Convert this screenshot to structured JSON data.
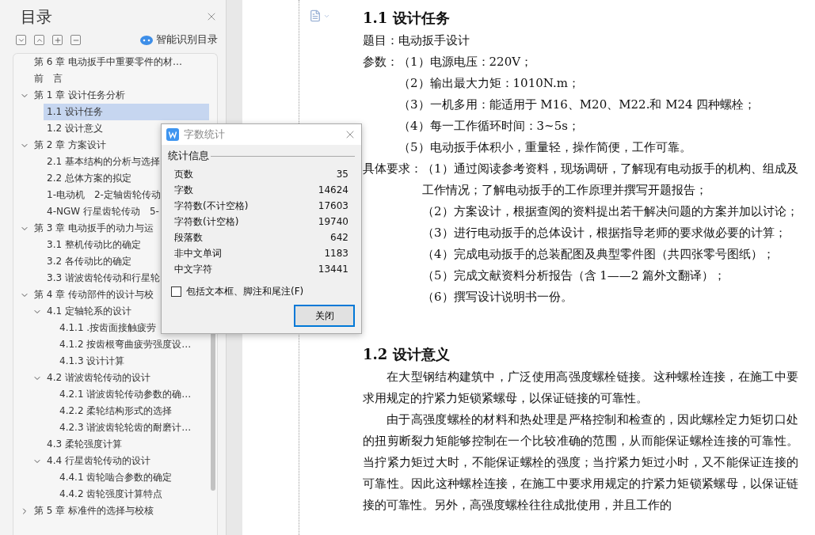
{
  "toc_panel": {
    "title": "目录",
    "smart_button": "智能识别目录",
    "items": [
      {
        "label": "第 6 章 电动扳手中重要零件的材…",
        "selected": false
      },
      {
        "label": "前　言",
        "selected": false
      },
      {
        "label": "第 1 章 设计任务分析",
        "selected": false,
        "expanded": true,
        "children": [
          {
            "label": "1.1 设计任务",
            "selected": true
          },
          {
            "label": "1.2 设计意义",
            "selected": false
          }
        ]
      },
      {
        "label": "第 2 章 方案设计",
        "selected": false,
        "expanded": true,
        "children": [
          {
            "label": "2.1 基本结构的分析与选择",
            "selected": false
          },
          {
            "label": "2.2 总体方案的拟定",
            "selected": false
          },
          {
            "label": "1-电动机　2-定轴齿轮传动",
            "selected": false
          },
          {
            "label": "4-NGW 行星齿轮传动　5-",
            "selected": false
          }
        ]
      },
      {
        "label": "第 3 章 电动扳手的动力与运",
        "selected": false,
        "expanded": true,
        "children": [
          {
            "label": "3.1 整机传动比的确定",
            "selected": false
          },
          {
            "label": "3.2 各传动比的确定",
            "selected": false
          },
          {
            "label": "3.3 谐波齿轮传动和行星轮",
            "selected": false
          }
        ]
      },
      {
        "label": "第 4 章 传动部件的设计与校",
        "selected": false,
        "expanded": true,
        "children": [
          {
            "label": "4.1 定轴轮系的设计",
            "selected": false,
            "expanded": true,
            "children": [
              {
                "label": "4.1.1 .按齿面接触疲劳",
                "selected": false
              },
              {
                "label": "4.1.2 按齿根弯曲疲劳强度设…",
                "selected": false
              },
              {
                "label": "4.1.3 设计计算",
                "selected": false
              }
            ]
          },
          {
            "label": "4.2 谐波齿轮传动的设计",
            "selected": false,
            "expanded": true,
            "children": [
              {
                "label": "4.2.1 谐波齿轮传动参数的确…",
                "selected": false
              },
              {
                "label": "4.2.2 柔轮结构形式的选择",
                "selected": false
              },
              {
                "label": "4.2.3 谐波齿轮轮齿的耐磨计…",
                "selected": false
              }
            ]
          },
          {
            "label": "4.3 柔轮强度计算",
            "selected": false
          },
          {
            "label": "4.4 行星齿轮传动的设计",
            "selected": false,
            "expanded": true,
            "children": [
              {
                "label": "4.4.1 齿轮啮合参数的确定",
                "selected": false
              },
              {
                "label": "4.4.2 齿轮强度计算特点",
                "selected": false
              }
            ]
          }
        ]
      },
      {
        "label": "第 5 章 标准件的选择与校核",
        "selected": false,
        "expanded": false
      }
    ]
  },
  "document": {
    "blocks": [
      {
        "kind": "heading",
        "text": "1.1 设计任务"
      },
      {
        "kind": "line",
        "text": "题目：电动扳手设计"
      },
      {
        "kind": "list",
        "label": "参数：",
        "items": [
          "（1）电源电压：220V；",
          "（2）输出最大力矩：1010N.m；",
          "（3）一机多用：能适用于 M16、M20、M22.和 M24 四种螺栓；",
          "（4）每一工作循环时间：3~5s；",
          "（5）电动扳手体积小，重量轻，操作简便，工作可靠。"
        ]
      },
      {
        "kind": "list",
        "label": "具体要求：",
        "items": [
          "（1）通过阅读参考资料，现场调研，了解现有电动扳手的机构、组成及工作情况；了解电动扳手的工作原理并撰写开题报告；",
          "（2）方案设计，根据查阅的资料提出若干解决问题的方案并加以讨论；",
          "（3）进行电动扳手的总体设计，根据指导老师的要求做必要的计算；",
          "（4）完成电动扳手的总装配图及典型零件图（共四张零号图纸）；",
          "（5）完成文献资料分析报告（含 1——2 篇外文翻译）；",
          "（6）撰写设计说明书一份。"
        ]
      },
      {
        "kind": "heading",
        "text": "1.2 设计意义"
      },
      {
        "kind": "paragraph",
        "text": "在大型钢结构建筑中，广泛使用高强度螺栓链接。这种螺栓连接，在施工中要求用规定的拧紧力矩锁紧螺母，以保证链接的可靠性。"
      },
      {
        "kind": "paragraph",
        "text": "由于高强度螺栓的材料和热处理是严格控制和检查的，因此螺栓定力矩切口处的扭剪断裂力矩能够控制在一个比较准确的范围，从而能保证螺栓连接的可靠性。当拧紧力矩过大时，不能保证螺栓的强度；当拧紧力矩过小时，又不能保证连接的可靠性。因此这种螺栓连接，在施工中要求用规定的拧紧力矩锁紧螺母，以保证链接的可靠性。另外，高强度螺栓往往成批使用，并且工作的"
      }
    ]
  },
  "word_count_dialog": {
    "title": "字数统计",
    "group": "统计信息",
    "stats": [
      {
        "label": "页数",
        "value": "35"
      },
      {
        "label": "字数",
        "value": "14624"
      },
      {
        "label": "字符数(不计空格)",
        "value": "17603"
      },
      {
        "label": "字符数(计空格)",
        "value": "19740"
      },
      {
        "label": "段落数",
        "value": "642"
      },
      {
        "label": "非中文单词",
        "value": "1183"
      },
      {
        "label": "中文字符",
        "value": "13441"
      }
    ],
    "include_checkbox": {
      "label": "包括文本框、脚注和尾注(F)",
      "checked": false
    },
    "close_button": "关闭"
  }
}
